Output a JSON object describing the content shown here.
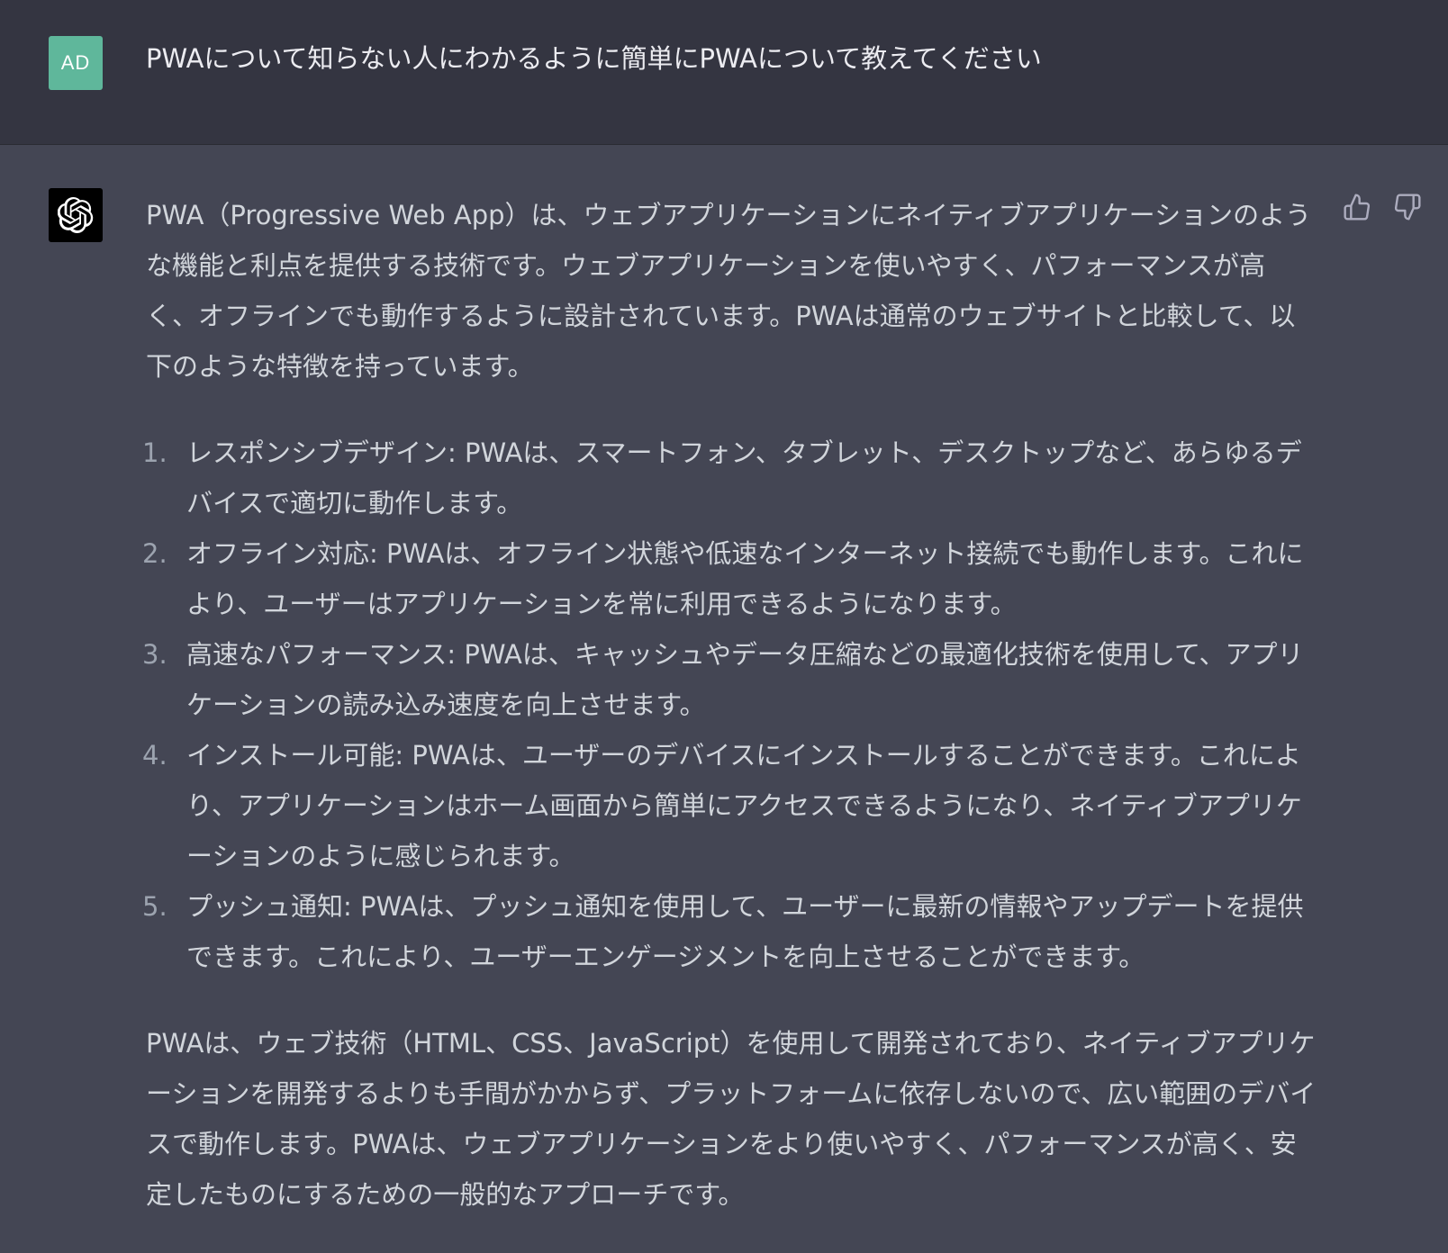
{
  "user": {
    "avatar_initials": "AD",
    "message": "PWAについて知らない人にわかるように簡単にPWAについて教えてください"
  },
  "assistant": {
    "avatar_icon": "openai-logo-icon",
    "intro": "PWA（Progressive Web App）は、ウェブアプリケーションにネイティブアプリケーションのような機能と利点を提供する技術です。ウェブアプリケーションを使いやすく、パフォーマンスが高く、オフラインでも動作するように設計されています。PWAは通常のウェブサイトと比較して、以下のような特徴を持っています。",
    "features": [
      {
        "number": "1.",
        "text": "レスポンシブデザイン: PWAは、スマートフォン、タブレット、デスクトップなど、あらゆるデバイスで適切に動作します。"
      },
      {
        "number": "2.",
        "text": "オフライン対応: PWAは、オフライン状態や低速なインターネット接続でも動作します。これにより、ユーザーはアプリケーションを常に利用できるようになります。"
      },
      {
        "number": "3.",
        "text": "高速なパフォーマンス: PWAは、キャッシュやデータ圧縮などの最適化技術を使用して、アプリケーションの読み込み速度を向上させます。"
      },
      {
        "number": "4.",
        "text": "インストール可能: PWAは、ユーザーのデバイスにインストールすることができます。これにより、アプリケーションはホーム画面から簡単にアクセスできるようになり、ネイティブアプリケーションのように感じられます。"
      },
      {
        "number": "5.",
        "text": "プッシュ通知: PWAは、プッシュ通知を使用して、ユーザーに最新の情報やアップデートを提供できます。これにより、ユーザーエンゲージメントを向上させることができます。"
      }
    ],
    "conclusion": "PWAは、ウェブ技術（HTML、CSS、JavaScript）を使用して開発されており、ネイティブアプリケーションを開発するよりも手間がかからず、プラットフォームに依存しないので、広い範囲のデバイスで動作します。PWAは、ウェブアプリケーションをより使いやすく、パフォーマンスが高く、安定したものにするための一般的なアプローチです。"
  },
  "feedback": {
    "like_icon": "thumbs-up-icon",
    "dislike_icon": "thumbs-down-icon"
  },
  "colors": {
    "user_bg": "#343541",
    "assistant_bg": "#444654",
    "user_avatar": "#5fb79b",
    "text": "#d1d5db"
  }
}
